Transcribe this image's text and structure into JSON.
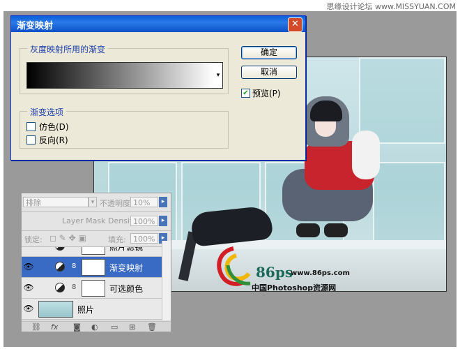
{
  "watermark": "思缘设计论坛 www.MISSYUAN.COM",
  "dialog": {
    "title": "渐变映射",
    "close_glyph": "✕",
    "gradient_group_label": "灰度映射所用的渐变",
    "options_group_label": "渐变选项",
    "ok_label": "确定",
    "cancel_label": "取消",
    "preview_label": "预览(P)",
    "preview_checked": true,
    "dither_label": "仿色(D)",
    "dither_checked": false,
    "reverse_label": "反向(R)",
    "reverse_checked": false,
    "gradient": {
      "from": "#000000",
      "to": "#ffffff"
    }
  },
  "layers_panel": {
    "blend_mode": "排除",
    "opacity_label": "不透明度:",
    "opacity_value": "10%",
    "density_label": "Layer Mask Density",
    "density_value": "100%",
    "lock_label": "锁定:",
    "fill_label": "填充:",
    "fill_value": "100%",
    "layers": [
      {
        "name": "照片滤镜",
        "kind": "adjustment",
        "visible": false,
        "selected": false
      },
      {
        "name": "渐变映射",
        "kind": "adjustment",
        "visible": true,
        "selected": true
      },
      {
        "name": "可选颜色",
        "kind": "adjustment",
        "visible": true,
        "selected": false
      },
      {
        "name": "照片",
        "kind": "image",
        "visible": true,
        "selected": false
      }
    ],
    "footer_icons": [
      "link-icon",
      "fx-icon",
      "mask-icon",
      "adjustment-icon",
      "group-icon",
      "new-layer-icon",
      "trash-icon"
    ]
  },
  "logo": {
    "mark": "86ps",
    "url": "www.86ps.com",
    "caption": "中国Photoshop资源网"
  },
  "colors": {
    "title_bar": "#0a5fd8",
    "dialog_bg": "#ece9d8",
    "group_label": "#1a3da8",
    "selected_layer": "#3a6bc4"
  }
}
